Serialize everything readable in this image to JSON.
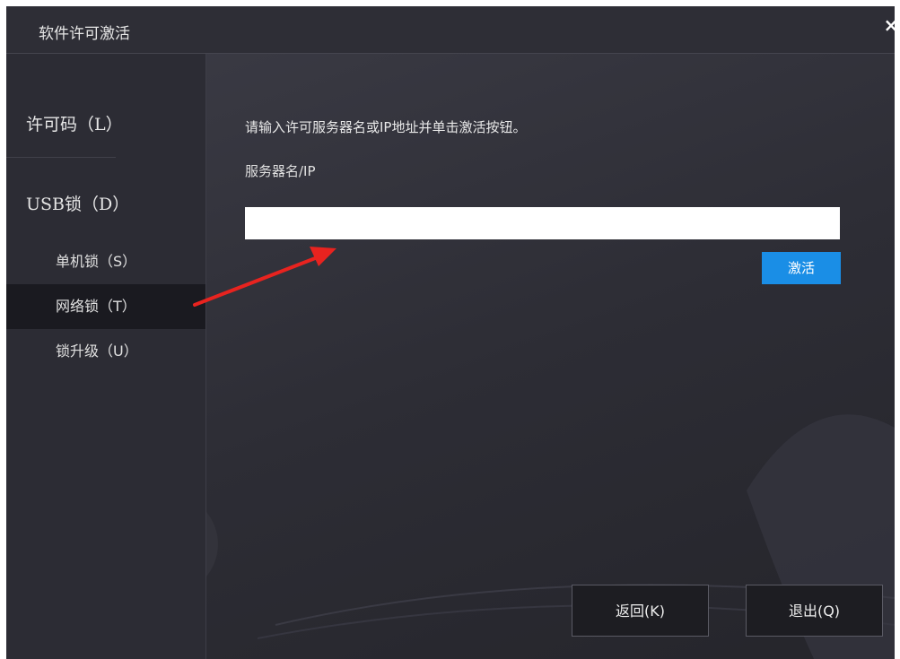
{
  "window": {
    "title": "软件许可激活",
    "close_symbol": "×"
  },
  "sidebar": {
    "license_code": "许可码（L）",
    "usb_lock": "USB锁（D）",
    "items": [
      {
        "label": "单机锁（S）",
        "active": false
      },
      {
        "label": "网络锁（T）",
        "active": true
      },
      {
        "label": "锁升级（U）",
        "active": false
      }
    ]
  },
  "main": {
    "instruction": "请输入许可服务器名或IP地址并单击激活按钮。",
    "field_label": "服务器名/IP",
    "server_value": "",
    "activate_label": "激活"
  },
  "footer": {
    "back_label": "返回(K)",
    "exit_label": "退出(Q)"
  },
  "colors": {
    "accent": "#1a8ee6",
    "arrow": "#e8231f",
    "background": "#2e2e36"
  }
}
